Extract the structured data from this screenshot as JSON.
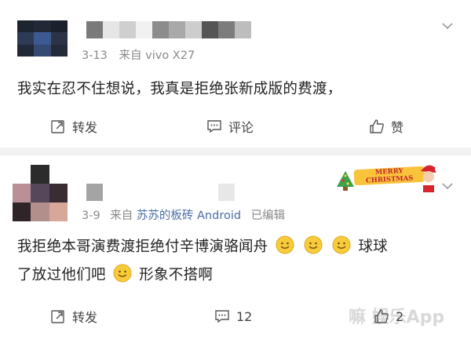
{
  "comments": [
    {
      "date": "3-13",
      "source_prefix": "来自",
      "source_name": "vivo X27",
      "edited": "",
      "text_line1": "我实在忍不住想说，我真是拒绝张新成版的费渡，",
      "text_line2_prefix": "",
      "text_line2_suffix": "",
      "actions": {
        "repost": "转发",
        "comment": "评论",
        "like": "赞"
      }
    },
    {
      "date": "3-9",
      "source_prefix": "来自",
      "source_name": "苏苏的板砖 Android",
      "edited": "已编辑",
      "text_line1": "我拒绝本哥演费渡拒绝付辛博演骆闻舟",
      "text_line1_after_emoji": "球球",
      "text_line2_prefix": "了放过他们吧",
      "text_line2_suffix": "形象不搭啊",
      "badge_text": "MERRY CHRISTMAS",
      "actions": {
        "repost": "转发",
        "comment": "12",
        "like": "2"
      }
    }
  ],
  "icons": [
    "repost-icon",
    "comment-icon",
    "like-icon",
    "chevron-down-icon",
    "smile-emoji-icon"
  ],
  "colors": {
    "page_bg": "#f2f2f2",
    "card_bg": "#ffffff",
    "source_blue": "#4a6da8",
    "meta_gray": "#8a8a8a"
  },
  "watermark": "嘛 娱乐App"
}
